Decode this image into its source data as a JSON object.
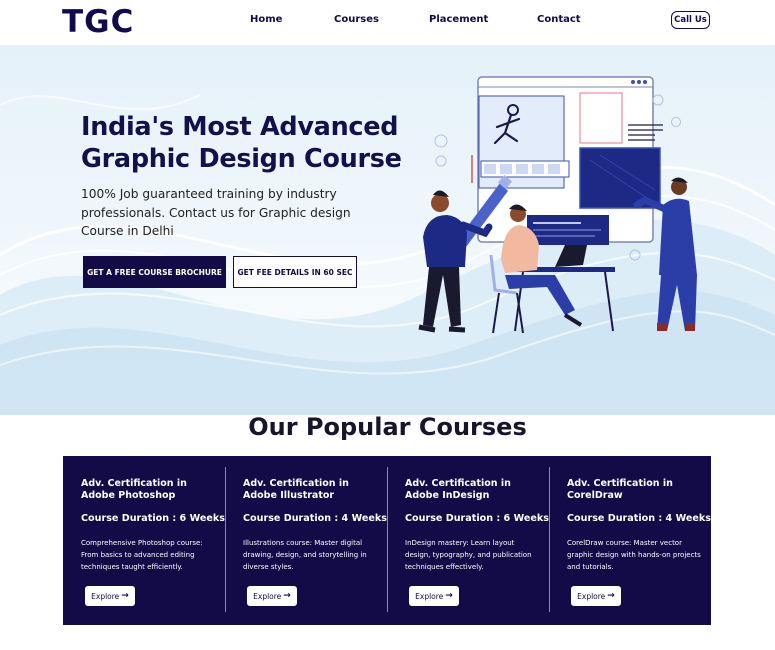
{
  "header": {
    "logo": "TGC",
    "nav": [
      "Home",
      "Courses",
      "Placement",
      "Contact"
    ],
    "call_label": "Call Us"
  },
  "hero": {
    "title": "India's Most Advanced Graphic Design Course",
    "subtitle": "100% Job guaranteed training by industry professionals. Contact us for Graphic design Course in Delhi",
    "primary_button": "GET A FREE COURSE BROCHURE",
    "secondary_button": "GET FEE DETAILS IN 60 SEC"
  },
  "courses": {
    "heading": "Our Popular Courses",
    "items": [
      {
        "title": "Adv. Certification in Adobe Photoshop",
        "duration": "Course Duration : 6 Weeks",
        "description": "Comprehensive Photoshop course: From basics to advanced editing techniques taught efficiently.",
        "button": "Explore"
      },
      {
        "title": "Adv. Certification in Adobe Illustrator",
        "duration": "Course Duration : 4 Weeks",
        "description": "Illustrations course: Master digital drawing, design, and storytelling in diverse styles.",
        "button": "Explore"
      },
      {
        "title": "Adv. Certification in Adobe InDesign",
        "duration": "Course Duration : 6 Weeks",
        "description": "InDesign mastery: Learn layout design, typography, and publication techniques effectively.",
        "button": "Explore"
      },
      {
        "title": "Adv. Certification in CorelDraw",
        "duration": "Course Duration : 4 Weeks",
        "description": "CorelDraw course: Master vector graphic design with hands-on projects and tutorials.",
        "button": "Explore"
      }
    ]
  },
  "colors": {
    "brand_navy": "#120b47",
    "hero_wave": "#cfe6f4",
    "illustration_blue": "#3b4fb8"
  },
  "icons": {
    "explore_arrow": "arrow-right-icon",
    "hero_art": "designers-illustration"
  }
}
